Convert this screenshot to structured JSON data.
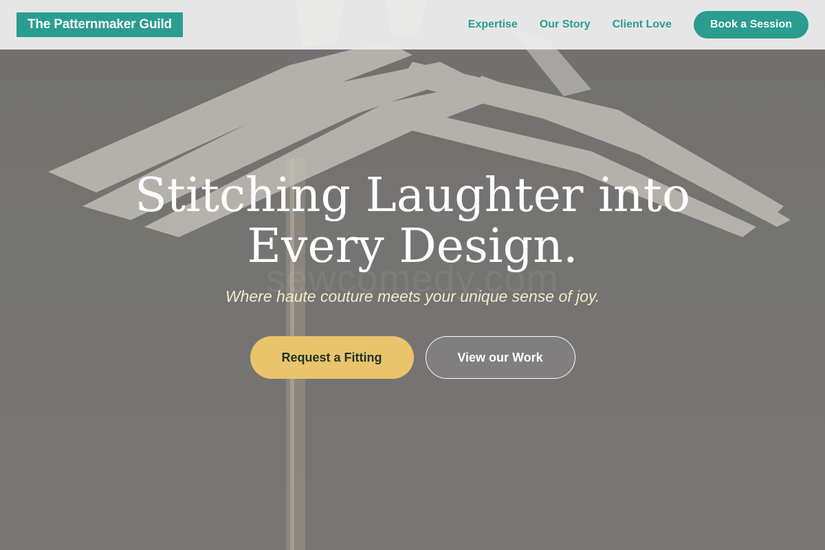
{
  "header": {
    "logo": "The Patternmaker Guild",
    "nav": [
      "Expertise",
      "Our Story",
      "Client Love"
    ],
    "cta": "Book a Session"
  },
  "hero": {
    "watermark": "sewcomedy.com",
    "title_line1": "Stitching Laughter into",
    "title_line2": "Every Design.",
    "subtitle": "Where haute couture meets your unique sense of joy.",
    "primary_button": "Request a Fitting",
    "secondary_button": "View our Work"
  },
  "colors": {
    "brand_teal": "#2a9d8f",
    "accent_gold": "#e9c46a",
    "subtitle_cream": "#f1ecc9"
  }
}
